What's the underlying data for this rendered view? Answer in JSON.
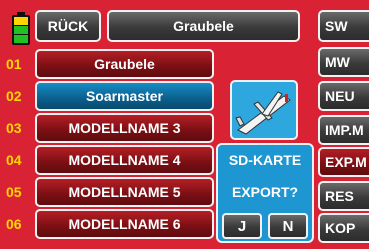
{
  "header": {
    "back_label": "RÜCK",
    "model_title": "Graubele"
  },
  "models": [
    {
      "num": "01",
      "name": "Graubele"
    },
    {
      "num": "02",
      "name": "Soarmaster"
    },
    {
      "num": "03",
      "name": "MODELLNAME 3"
    },
    {
      "num": "04",
      "name": "MODELLNAME 4"
    },
    {
      "num": "05",
      "name": "MODELLNAME 5"
    },
    {
      "num": "06",
      "name": "MODELLNAME 6"
    }
  ],
  "side_buttons": [
    "SW",
    "MW",
    "NEU",
    "IMP.M",
    "EXP.M",
    "RES",
    "KOP"
  ],
  "dialog": {
    "line1": "SD-KARTE",
    "line2": "EXPORT?",
    "yes": "J",
    "no": "N"
  },
  "colors": {
    "background": "#d92233",
    "number": "#ffd600",
    "dialog": "#1e96d2",
    "active_row": "#0b5f8c"
  }
}
